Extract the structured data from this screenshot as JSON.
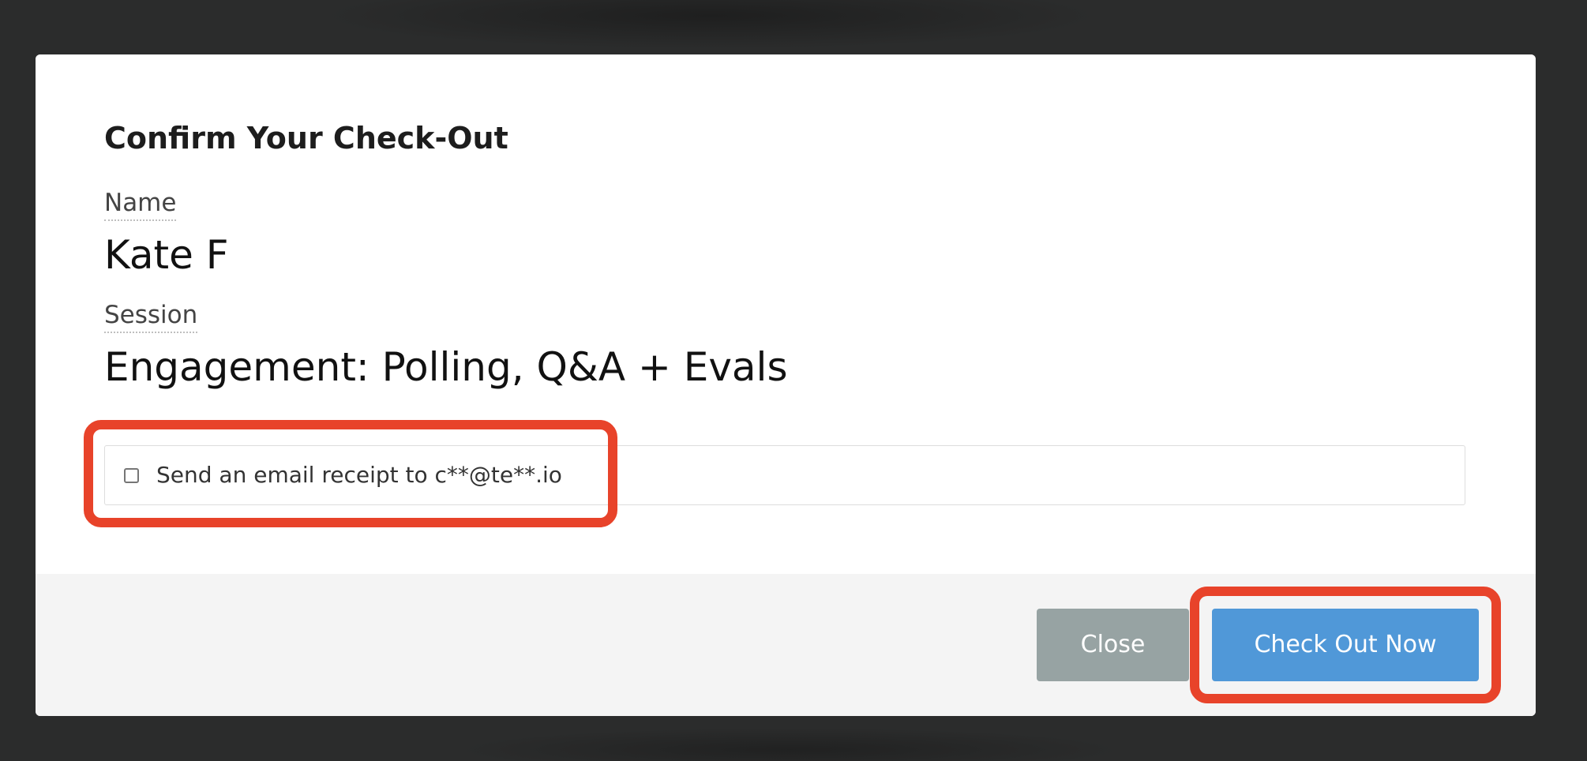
{
  "modal": {
    "title": "Confirm Your Check-Out",
    "fields": {
      "name_label": "Name",
      "name_value": "Kate F",
      "session_label": "Session",
      "session_value": "Engagement: Polling, Q&A + Evals"
    },
    "receipt": {
      "checked": false,
      "label": "Send an email receipt to c**@te**.io"
    },
    "footer": {
      "close_label": "Close",
      "checkout_label": "Check Out Now"
    }
  },
  "colors": {
    "backdrop": "#2b2c2c",
    "close_button": "#97a3a3",
    "checkout_button": "#5098d8",
    "highlight": "#e8432a",
    "footer_bg": "#f4f4f4"
  }
}
